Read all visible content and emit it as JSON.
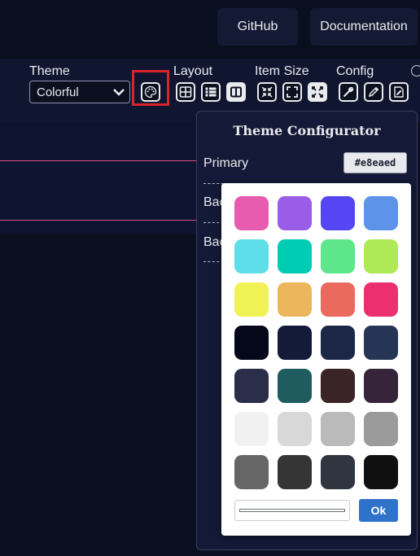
{
  "header": {
    "github_label": "GitHub",
    "docs_label": "Documentation"
  },
  "settings": {
    "theme_label": "Theme",
    "theme_value": "Colorful",
    "layout_label": "Layout",
    "item_size_label": "Item Size",
    "config_label": "Config"
  },
  "configurator": {
    "title": "Theme Configurator",
    "primary_label": "Primary",
    "primary_value": "#e8eaed",
    "row2_label_partial": "Bac",
    "row3_label_partial": "Bac"
  },
  "color_picker": {
    "swatches": [
      "#e85cb0",
      "#9a5de8",
      "#5446f2",
      "#5d93e8",
      "#5ddee8",
      "#00ccb4",
      "#5ee68a",
      "#aeea55",
      "#f0f255",
      "#ebb65c",
      "#ea6a5d",
      "#ec2f6f",
      "#040818",
      "#131a3a",
      "#1c2646",
      "#263456",
      "#2b2e48",
      "#1e5c60",
      "#3a2426",
      "#35243a",
      "#f1f1f1",
      "#d8d8d8",
      "#bababa",
      "#9b9b9b",
      "#666666",
      "#353535",
      "#30363f",
      "#101010"
    ],
    "ok_label": "Ok"
  }
}
